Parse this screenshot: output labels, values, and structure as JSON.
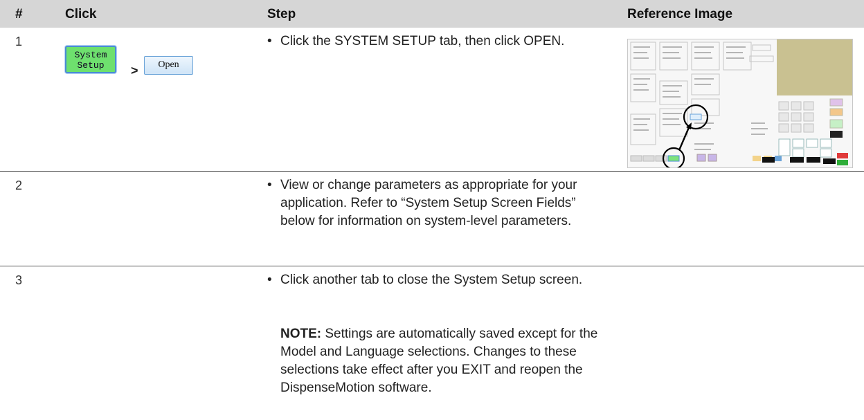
{
  "table": {
    "headers": {
      "num": "#",
      "click": "Click",
      "step": "Step",
      "ref": "Reference Image"
    },
    "rows": [
      {
        "num": "1",
        "click": {
          "button1": "System\nSetup",
          "separator": ">",
          "button2": "Open"
        },
        "step": "Click the SYSTEM SETUP tab, then click OPEN."
      },
      {
        "num": "2",
        "step": "View or change parameters as appropriate for your application. Refer to “System Setup Screen Fields” below for information on system-level parameters."
      },
      {
        "num": "3",
        "step": "Click another tab to close the System Setup screen.",
        "note_label": "NOTE:",
        "note_text": " Settings are automatically saved except for the Model and Language selections. Changes to these selections take effect after you EXIT and reopen the DispenseMotion software."
      }
    ]
  },
  "bullet": "•"
}
